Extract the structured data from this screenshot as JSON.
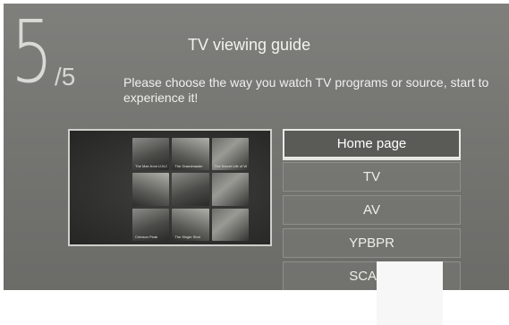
{
  "guide": {
    "step_current": "5",
    "step_total": "/5",
    "title": "TV viewing guide",
    "description": "Please choose the way you watch TV programs or source, start to experience it!"
  },
  "preview": {
    "posters": [
      "The Man from U.N.C.L.E.",
      "The Grandmaster",
      "The Secret Life of Wal",
      "",
      "",
      "",
      "Crimson Peak",
      "The Single Shot",
      ""
    ]
  },
  "menu": {
    "items": [
      {
        "label": "Home page",
        "selected": true
      },
      {
        "label": "TV",
        "selected": false
      },
      {
        "label": "AV",
        "selected": false
      },
      {
        "label": "YPBPR",
        "selected": false
      },
      {
        "label": "SCART",
        "selected": false
      }
    ]
  },
  "colors": {
    "screen_bg": "#777774",
    "text": "#f0f0ec",
    "selected_border": "#e9e9e5"
  }
}
